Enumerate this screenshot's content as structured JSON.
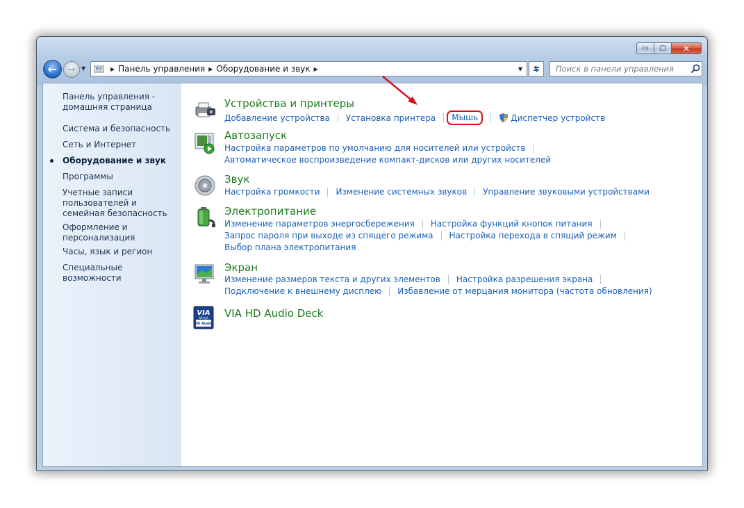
{
  "window": {
    "buttons": {
      "minimize": "▭",
      "maximize": "▢",
      "close": "✕"
    }
  },
  "navigation": {
    "back_icon": "←",
    "forward_icon": "→",
    "dropdown_icon": "▼"
  },
  "address": {
    "breadcrumbs": [
      "Панель управления",
      "Оборудование и звук"
    ],
    "separator": "▶"
  },
  "search": {
    "placeholder": "Поиск в панели управления"
  },
  "sidebar": {
    "items": [
      {
        "label": "Панель управления - домашняя страница"
      },
      {
        "label": "Система и безопасность"
      },
      {
        "label": "Сеть и Интернет"
      },
      {
        "label": "Оборудование и звук",
        "active": true
      },
      {
        "label": "Программы"
      },
      {
        "label": "Учетные записи пользователей и семейная безопасность"
      },
      {
        "label": "Оформление и персонализация"
      },
      {
        "label": "Часы, язык и регион"
      },
      {
        "label": "Специальные возможности"
      }
    ]
  },
  "categories": [
    {
      "title": "Устройства и принтеры",
      "icon": "printer-camera-icon",
      "links": [
        "Добавление устройства",
        "Установка принтера",
        "Мышь",
        "Диспетчер устройств"
      ]
    },
    {
      "title": "Автозапуск",
      "icon": "autoplay-icon",
      "links": [
        "Настройка параметров по умолчанию для носителей или устройств",
        "Автоматическое воспроизведение компакт-дисков или других носителей"
      ]
    },
    {
      "title": "Звук",
      "icon": "speaker-icon",
      "links": [
        "Настройка громкости",
        "Изменение системных звуков",
        "Управление звуковыми устройствами"
      ]
    },
    {
      "title": "Электропитание",
      "icon": "battery-power-icon",
      "links": [
        "Изменение параметров энергосбережения",
        "Настройка функций кнопок питания",
        "Запрос пароля при выходе из спящего режима",
        "Настройка перехода в спящий режим",
        "Выбор плана электропитания"
      ]
    },
    {
      "title": "Экран",
      "icon": "monitor-icon",
      "links": [
        "Изменение размеров текста и других элементов",
        "Настройка разрешения экрана",
        "Подключение к внешнему дисплею",
        "Избавление от мерцания монитора (частота обновления)"
      ]
    },
    {
      "title": "VIA HD Audio Deck",
      "icon": "via-audio-icon",
      "badge_text": [
        "VIA",
        "Vinyl",
        "HD Audio"
      ],
      "links": []
    }
  ],
  "colors": {
    "category_title": "#1e7a1e",
    "link": "#1a5fb4",
    "annotation": "#d4111b"
  }
}
